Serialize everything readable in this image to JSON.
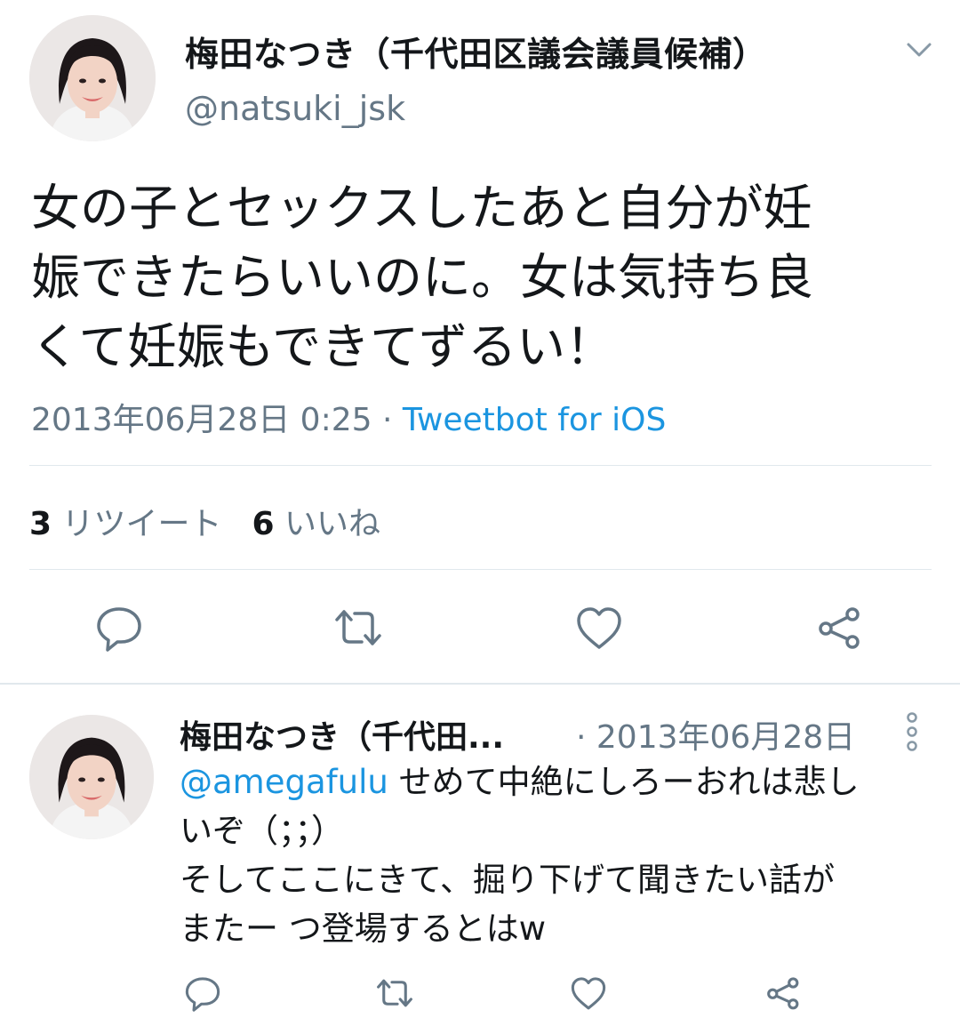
{
  "tweet": {
    "author_name": "梅田なつき（千代田区議会議員候補）",
    "author_handle": "@natsuki_jsk",
    "text_lines": [
      "女の子とセックスしたあと自分が妊",
      "娠できたらいいのに。女は気持ち良",
      "くて妊娠もできてずるい！"
    ],
    "timestamp": "2013年06月28日 0:25",
    "separator": " · ",
    "source": "Tweetbot for iOS",
    "retweet_count": "3",
    "retweet_label": "リツイート",
    "like_count": "6",
    "like_label": "いいね"
  },
  "reply": {
    "author_name": "梅田なつき（千代田...",
    "date": "· 2013年06月28日",
    "mention": "@amegafulu",
    "text_line1_rest": " せめて中絶にしろーおれは悲し",
    "text_lines": [
      "いぞ（；；）",
      "そしてここにきて、掘り下げて聞きたい話が",
      "またー つ登場するとはw"
    ]
  },
  "icons": {
    "reply": "reply-icon",
    "retweet": "retweet-icon",
    "like": "heart-icon",
    "share": "share-icon",
    "chevron": "chevron-down-icon",
    "more": "kebab-menu-icon"
  },
  "colors": {
    "text": "#14171a",
    "secondary": "#657786",
    "link": "#1b95e0",
    "divider": "#e1e8ed",
    "icon": "#657786"
  }
}
